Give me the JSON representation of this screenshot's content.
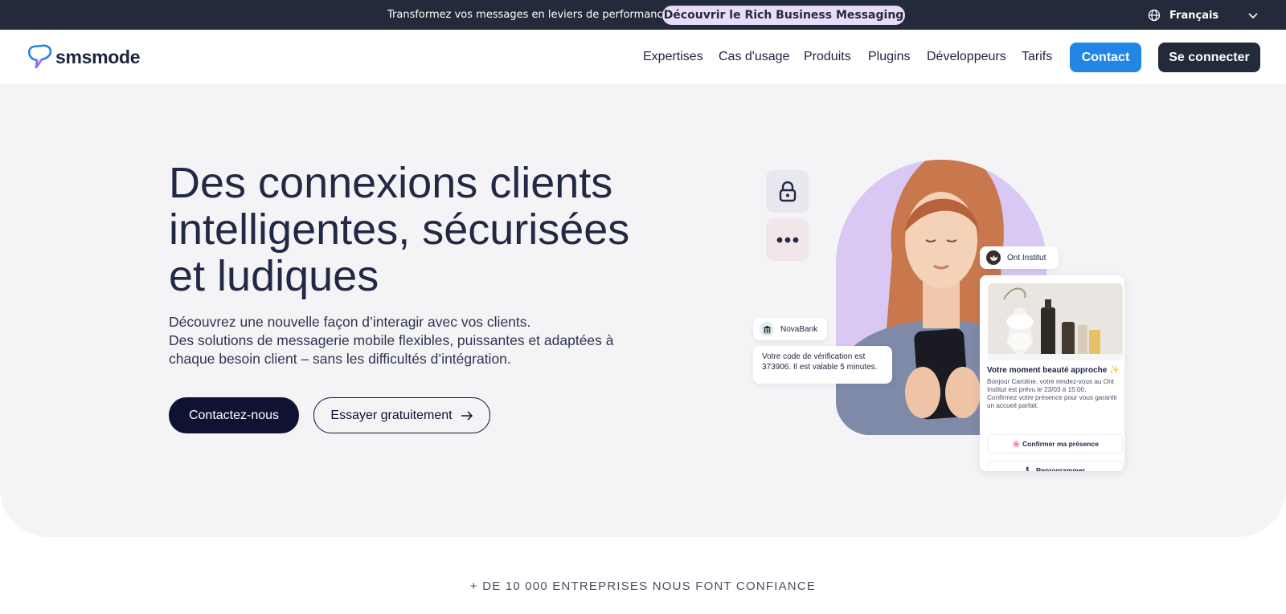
{
  "announcement": {
    "message": "Transformez vos messages en leviers de performance",
    "cta": "Découvrir le Rich Business Messaging",
    "language": "Français"
  },
  "nav": {
    "brand": "smsmode",
    "links": [
      "Expertises",
      "Cas d'usage",
      "Produits",
      "Plugins",
      "Développeurs",
      "Tarifs"
    ],
    "contact": "Contact",
    "login": "Se connecter"
  },
  "hero": {
    "title": "Des connexions clients intelligentes, sécurisées et ludiques",
    "subtitle_lines": [
      "Découvrez une nouvelle façon d’interagir avec vos clients.",
      "Des solutions de messagerie mobile flexibles, puissantes et adaptées à",
      "chaque besoin client – sans les difficultés d’intégration."
    ],
    "primary_button": "Contactez-nous",
    "secondary_button": "Essayer gratuitement"
  },
  "visual": {
    "bank_name": "NovaBank",
    "bank_message": "Votre code de vérification est 373906. Il est valable 5 minutes.",
    "institute_name": "Ont Institut",
    "rbm_title": "Votre moment beauté approche ✨",
    "rbm_body": "Bonjour Caroline, votre rendez-vous au Ont Institut est prévu le 23/03 à 15:00. Confirmez votre présence pour vous garantir un accueil parfait.",
    "rbm_action_confirm": "🌸 Confirmer ma présence",
    "rbm_action_reschedule": "📞 Reprogrammer"
  },
  "trust_line": "+ DE 10 000 ENTREPRISES NOUS FONT CONFIANCE",
  "colors": {
    "topbar": "#232b3a",
    "pill": "#e7dcfa",
    "accent_blue": "#2385e6",
    "navy": "#0e1334",
    "hero_bg": "#f4f4f6",
    "arch": "#d9c8f4"
  }
}
